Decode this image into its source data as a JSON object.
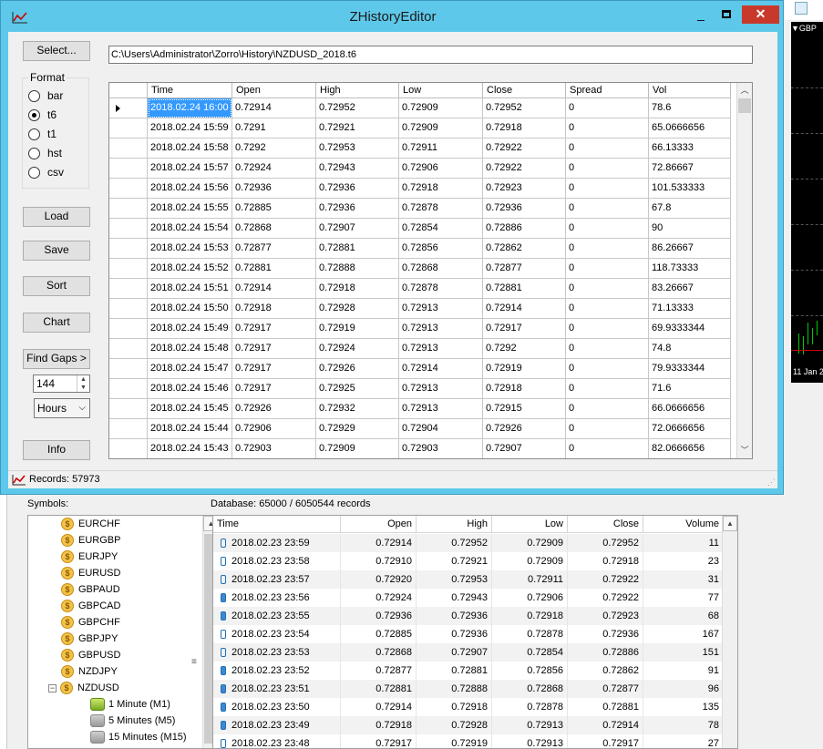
{
  "window": {
    "title": "ZHistoryEditor",
    "minimize_label": "_",
    "close_label": "✕"
  },
  "controls": {
    "select_button": "Select...",
    "file_path": "C:\\Users\\Administrator\\Zorro\\History\\NZDUSD_2018.t6",
    "format_label": "Format",
    "formats": [
      "bar",
      "t6",
      "t1",
      "hst",
      "csv"
    ],
    "selected_format": "t6",
    "load_button": "Load",
    "save_button": "Save",
    "sort_button": "Sort",
    "chart_button": "Chart",
    "find_gaps_button": "Find Gaps >",
    "gap_value": "144",
    "gap_unit": "Hours",
    "info_button": "Info"
  },
  "grid": {
    "columns": [
      "Time",
      "Open",
      "High",
      "Low",
      "Close",
      "Spread",
      "Vol"
    ],
    "rows": [
      [
        "2018.02.24 16:00",
        "0.72914",
        "0.72952",
        "0.72909",
        "0.72952",
        "0",
        "78.6"
      ],
      [
        "2018.02.24 15:59",
        "0.7291",
        "0.72921",
        "0.72909",
        "0.72918",
        "0",
        "65.0666656"
      ],
      [
        "2018.02.24 15:58",
        "0.7292",
        "0.72953",
        "0.72911",
        "0.72922",
        "0",
        "66.13333"
      ],
      [
        "2018.02.24 15:57",
        "0.72924",
        "0.72943",
        "0.72906",
        "0.72922",
        "0",
        "72.86667"
      ],
      [
        "2018.02.24 15:56",
        "0.72936",
        "0.72936",
        "0.72918",
        "0.72923",
        "0",
        "101.533333"
      ],
      [
        "2018.02.24 15:55",
        "0.72885",
        "0.72936",
        "0.72878",
        "0.72936",
        "0",
        "67.8"
      ],
      [
        "2018.02.24 15:54",
        "0.72868",
        "0.72907",
        "0.72854",
        "0.72886",
        "0",
        "90"
      ],
      [
        "2018.02.24 15:53",
        "0.72877",
        "0.72881",
        "0.72856",
        "0.72862",
        "0",
        "86.26667"
      ],
      [
        "2018.02.24 15:52",
        "0.72881",
        "0.72888",
        "0.72868",
        "0.72877",
        "0",
        "118.73333"
      ],
      [
        "2018.02.24 15:51",
        "0.72914",
        "0.72918",
        "0.72878",
        "0.72881",
        "0",
        "83.26667"
      ],
      [
        "2018.02.24 15:50",
        "0.72918",
        "0.72928",
        "0.72913",
        "0.72914",
        "0",
        "71.13333"
      ],
      [
        "2018.02.24 15:49",
        "0.72917",
        "0.72919",
        "0.72913",
        "0.72917",
        "0",
        "69.9333344"
      ],
      [
        "2018.02.24 15:48",
        "0.72917",
        "0.72924",
        "0.72913",
        "0.7292",
        "0",
        "74.8"
      ],
      [
        "2018.02.24 15:47",
        "0.72917",
        "0.72926",
        "0.72914",
        "0.72919",
        "0",
        "79.9333344"
      ],
      [
        "2018.02.24 15:46",
        "0.72917",
        "0.72925",
        "0.72913",
        "0.72918",
        "0",
        "71.6"
      ],
      [
        "2018.02.24 15:45",
        "0.72926",
        "0.72932",
        "0.72913",
        "0.72915",
        "0",
        "66.0666656"
      ],
      [
        "2018.02.24 15:44",
        "0.72906",
        "0.72929",
        "0.72904",
        "0.72926",
        "0",
        "72.0666656"
      ],
      [
        "2018.02.24 15:43",
        "0.72903",
        "0.72909",
        "0.72903",
        "0.72907",
        "0",
        "82.0666656"
      ]
    ]
  },
  "status": {
    "records": "Records: 57973"
  },
  "navigator": {
    "symbols_label": "Symbols:",
    "database_label": "Database: 65000 / 6050544 records",
    "symbols": [
      "EURCHF",
      "EURGBP",
      "EURJPY",
      "EURUSD",
      "GBPAUD",
      "GBPCAD",
      "GBPCHF",
      "GBPJPY",
      "GBPUSD",
      "NZDJPY",
      "NZDUSD"
    ],
    "timeframes": [
      "1 Minute (M1)",
      "5 Minutes (M5)",
      "15 Minutes (M15)"
    ],
    "db_columns": [
      "Time",
      "Open",
      "High",
      "Low",
      "Close",
      "Volume"
    ],
    "db_rows": [
      [
        "2018.02.23 23:59",
        "0.72914",
        "0.72952",
        "0.72909",
        "0.72952",
        "11"
      ],
      [
        "2018.02.23 23:58",
        "0.72910",
        "0.72921",
        "0.72909",
        "0.72918",
        "23"
      ],
      [
        "2018.02.23 23:57",
        "0.72920",
        "0.72953",
        "0.72911",
        "0.72922",
        "31"
      ],
      [
        "2018.02.23 23:56",
        "0.72924",
        "0.72943",
        "0.72906",
        "0.72922",
        "77"
      ],
      [
        "2018.02.23 23:55",
        "0.72936",
        "0.72936",
        "0.72918",
        "0.72923",
        "68"
      ],
      [
        "2018.02.23 23:54",
        "0.72885",
        "0.72936",
        "0.72878",
        "0.72936",
        "167"
      ],
      [
        "2018.02.23 23:53",
        "0.72868",
        "0.72907",
        "0.72854",
        "0.72886",
        "151"
      ],
      [
        "2018.02.23 23:52",
        "0.72877",
        "0.72881",
        "0.72856",
        "0.72862",
        "91"
      ],
      [
        "2018.02.23 23:51",
        "0.72881",
        "0.72888",
        "0.72868",
        "0.72877",
        "96"
      ],
      [
        "2018.02.23 23:50",
        "0.72914",
        "0.72918",
        "0.72878",
        "0.72881",
        "135"
      ],
      [
        "2018.02.23 23:49",
        "0.72918",
        "0.72928",
        "0.72913",
        "0.72914",
        "78"
      ],
      [
        "2018.02.23 23:48",
        "0.72917",
        "0.72919",
        "0.72913",
        "0.72917",
        "27"
      ]
    ]
  },
  "background": {
    "chart_symbol": "▼GBP",
    "chart_date": "11 Jan 2"
  },
  "colors": {
    "titlebar": "#5ec8ea",
    "selection": "#3399ff",
    "close_button": "#c8392b"
  }
}
